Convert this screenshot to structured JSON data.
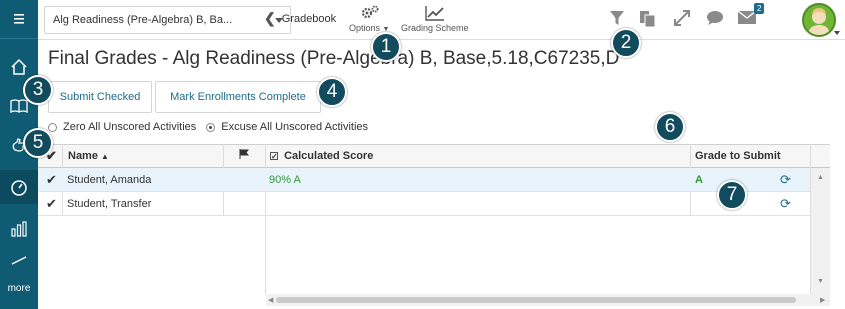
{
  "sidebar": {
    "items": [
      {
        "icon": "hamburger-menu-icon"
      },
      {
        "icon": "home-icon"
      },
      {
        "icon": "book-icon"
      },
      {
        "icon": "gradebook-hand-icon"
      },
      {
        "icon": "speedometer-icon"
      },
      {
        "icon": "bar-chart-icon"
      },
      {
        "icon": "partial-icon"
      }
    ],
    "more_label": "more",
    "active_index": 4
  },
  "topbar": {
    "course_select_value": "Alg Readiness (Pre-Algebra) B, Ba...",
    "gradebook_label": "Gradebook",
    "options_label": "Options",
    "grading_scheme_label": "Grading Scheme",
    "mail_count": "2"
  },
  "page": {
    "title": "Final Grades - Alg Readiness (Pre-Algebra) B, Base,5.18,C67235,D",
    "submit_checked_label": "Submit Checked",
    "mark_complete_label": "Mark Enrollments Complete",
    "radio_zero_label": "Zero All Unscored Activities",
    "radio_excuse_label": "Excuse All Unscored Activities"
  },
  "grid": {
    "headers": {
      "name": "Name",
      "calculated": "Calculated Score",
      "grade": "Grade to Submit"
    },
    "rows": [
      {
        "name": "Student, Amanda",
        "score": "90% A",
        "grade": "A",
        "selected": true
      },
      {
        "name": "Student, Transfer",
        "score": "",
        "grade": "",
        "selected": false
      }
    ]
  },
  "callouts": [
    "1",
    "2",
    "3",
    "4",
    "5",
    "6",
    "7"
  ],
  "colors": {
    "sidebar": "#0f5b74",
    "accent": "#1d6d8a",
    "score_green": "#2e9a3a",
    "callout": "#124b5e"
  }
}
